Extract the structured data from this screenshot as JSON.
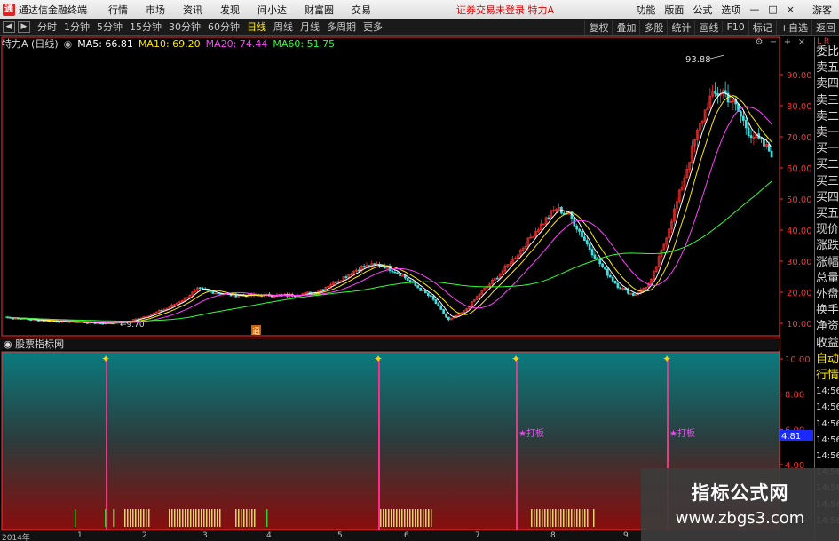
{
  "titlebar": {
    "app_name": "通达信金融终端",
    "menu": [
      "行情",
      "市场",
      "资讯",
      "发现",
      "问小达",
      "财富圈",
      "交易"
    ],
    "status": "证券交易未登录",
    "stock_name": "特力A",
    "right_menu": [
      "功能",
      "版面",
      "公式",
      "选项"
    ],
    "guest": "游客"
  },
  "toolbar": {
    "periods": [
      "分时",
      "1分钟",
      "5分钟",
      "15分钟",
      "30分钟",
      "60分钟",
      "日线",
      "周线",
      "月线",
      "多周期",
      "更多"
    ],
    "active_period": "日线",
    "right_tools": [
      "复权",
      "叠加",
      "多股",
      "统计",
      "画线",
      "F10",
      "标记",
      "+自选",
      "返回"
    ]
  },
  "kline": {
    "title": "特力A (日线)",
    "ma5": "MA5: 66.81",
    "ma10": "MA10: 69.20",
    "ma20": "MA20: 74.44",
    "ma60": "MA60: 51.75",
    "high_label": "93.88",
    "low_label": "9.70",
    "marker_label": "逼"
  },
  "colors": {
    "ma5": "#ffffff",
    "ma10": "#ffea00",
    "ma20": "#ff40ff",
    "ma60": "#30ff30",
    "up": "#ff3030",
    "down": "#40e0e0",
    "axis": "#ff3030"
  },
  "price_axis": [
    "90.00",
    "80.00",
    "70.00",
    "60.00",
    "50.00",
    "40.00",
    "30.00",
    "20.00",
    "10.00"
  ],
  "sub_indicator": {
    "title": "股票指标网",
    "axis": [
      "10.00",
      "8.00",
      "6.00",
      "4.00"
    ],
    "current_value": "4.81",
    "signal_label": "★打板"
  },
  "right_panel": {
    "lr": "L R",
    "items": [
      "委比",
      "卖五",
      "卖四",
      "卖三",
      "卖二",
      "卖一",
      "买一",
      "买二",
      "买三",
      "买四",
      "买五",
      "现价",
      "涨跌",
      "涨幅",
      "总量",
      "外盘",
      "换手",
      "净资",
      "收益",
      "自动",
      "行情",
      "14:56",
      "14:56",
      "14:56",
      "14:56",
      "14:56",
      "14:56",
      "14:56",
      "14:56",
      "14:56"
    ]
  },
  "time_axis": [
    "2014年",
    "1",
    "2",
    "3",
    "4",
    "5",
    "6",
    "7",
    "8",
    "9"
  ],
  "watermark": {
    "line1": "指标公式网",
    "line2": "www.zbgs3.com"
  }
}
